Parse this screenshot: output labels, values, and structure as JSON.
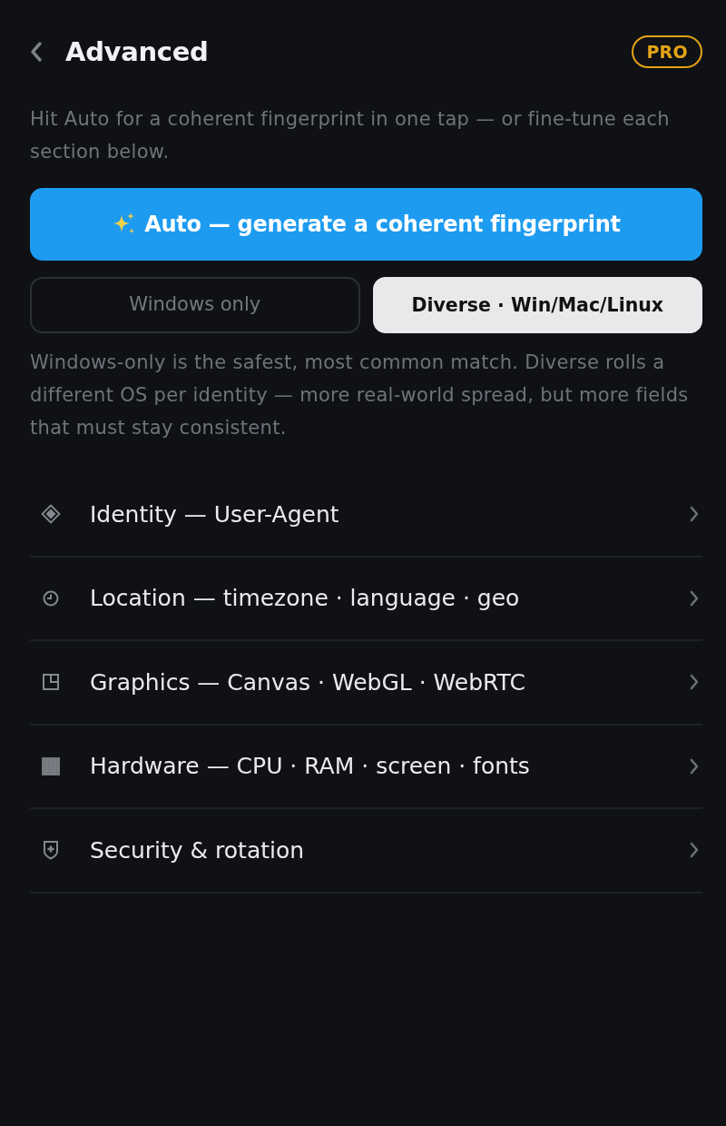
{
  "header": {
    "title": "Advanced",
    "badge": "PRO"
  },
  "intro": "Hit Auto for a coherent fingerprint in one tap — or fine-tune each section below.",
  "auto_button": {
    "label": "Auto — generate a coherent fingerprint"
  },
  "os_modes": [
    {
      "label": "Windows only",
      "selected": false
    },
    {
      "label": "Diverse · Win/Mac/Linux",
      "selected": true
    }
  ],
  "os_note": "Windows-only is the safest, most common match. Diverse rolls a different OS per identity — more real-world spread, but more fields that must stay consistent.",
  "sections": [
    {
      "kind": "identity",
      "label": "Identity — User-Agent"
    },
    {
      "kind": "location",
      "label": "Location — timezone · language · geo"
    },
    {
      "kind": "graphics",
      "label": "Graphics — Canvas · WebGL · WebRTC"
    },
    {
      "kind": "hardware",
      "label": "Hardware — CPU · RAM · screen · fonts"
    },
    {
      "kind": "security",
      "label": "Security & rotation"
    }
  ]
}
